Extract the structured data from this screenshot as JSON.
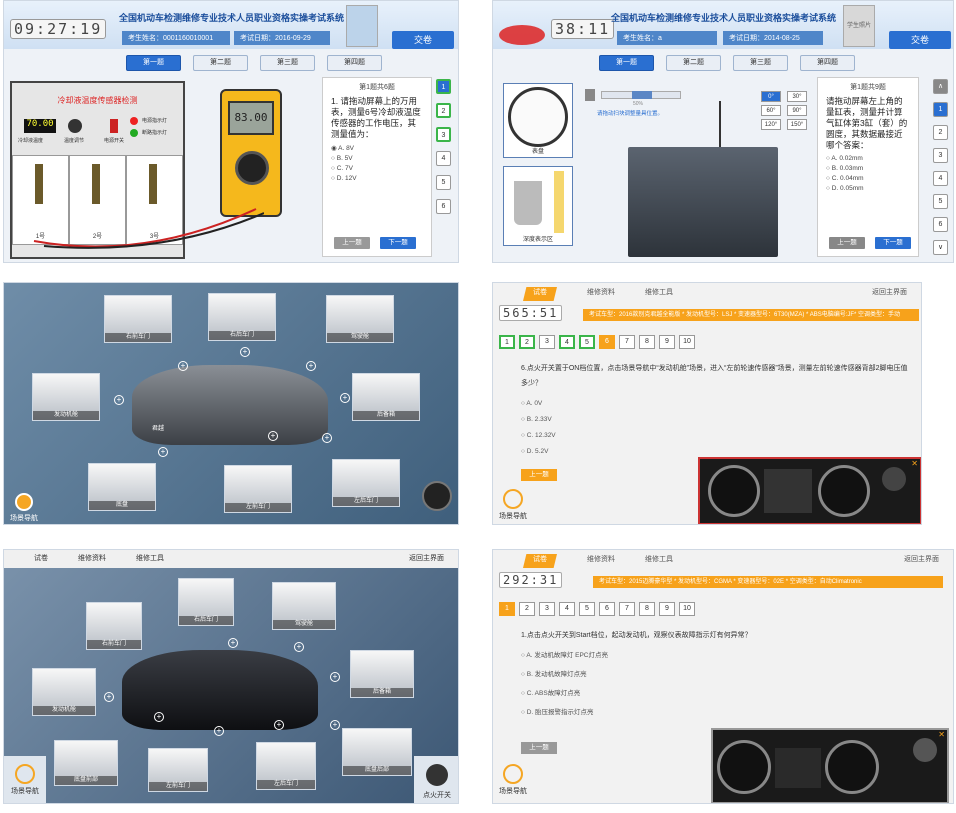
{
  "p1": {
    "timer": "09:27:19",
    "title": "全国机动车检测维修专业技术人员职业资格实操考试系统",
    "examinee": "考生姓名：0001160010001",
    "date": "考试日期：2016-09-29",
    "submit": "交卷",
    "tabs": [
      "第一题",
      "第二题",
      "第三题",
      "第四题"
    ],
    "device_title": "冷却液温度传感器检测",
    "display": "70.00",
    "labels": [
      "冷却液温度",
      "温度调节",
      "电源开关",
      "电源指示灯",
      "断路指示灯"
    ],
    "sensors": [
      "1号",
      "2号",
      "3号"
    ],
    "mm_value": "83.00",
    "q_head": "第1题共6题",
    "q_text": "1. 请拖动屏幕上的万用表，测量6号冷却液温度传感器的工作电压，其测量值为：",
    "options": [
      "A. 8V",
      "B. 5V",
      "C. 7V",
      "D. 12V"
    ],
    "prev": "上一题",
    "next": "下一题",
    "qnums": [
      "1",
      "2",
      "3",
      "4",
      "5",
      "6"
    ]
  },
  "p2": {
    "timer": "38:11",
    "title": "全国机动车检测维修专业技术人员职业资格实操考试系统",
    "examinee": "考生姓名：a",
    "date": "考试日期：2014-08-25",
    "avatar": "学生照片",
    "submit": "交卷",
    "tabs": [
      "第一题",
      "第二题",
      "第三题",
      "第四题"
    ],
    "gauge_label": "表盘",
    "depth_label": "深度表示区",
    "instruction": "请拖动扫块调整量具位置。",
    "slider_percent": "50%",
    "angles": [
      "0°",
      "30°",
      "60°",
      "90°",
      "120°",
      "150°"
    ],
    "q_head": "第1题共9题",
    "q_text": "请拖动屏幕左上角的量缸表，测量并计算气缸体第3缸（套）的圆度，其数据最接近哪个答案：",
    "options": [
      "A. 0.02mm",
      "B. 0.03mm",
      "C. 0.04mm",
      "D. 0.05mm"
    ],
    "prev": "上一题",
    "next": "下一题",
    "qnums": [
      "1",
      "2",
      "3",
      "4",
      "5",
      "6"
    ],
    "up": "∧",
    "down": "∨"
  },
  "p3": {
    "thumbs": [
      "右前车门",
      "右后车门",
      "驾驶舱",
      "发动机舱",
      "后备箱",
      "底盘",
      "左前车门",
      "左后车门"
    ],
    "car_badge": "君越",
    "nav": "场景导航"
  },
  "p4": {
    "menu": [
      "试卷",
      "维修资料",
      "维修工具"
    ],
    "back": "返回主界面",
    "timer": "565:51",
    "bar": "考试车型：2016款别克君越全能版 * 发动机型号：LSJ * 变速器型号：6T30(MZA) * ABS电脑编号:JF* 空调类型：手动",
    "qnums": [
      "1",
      "2",
      "3",
      "4",
      "5",
      "6",
      "7",
      "8",
      "9",
      "10"
    ],
    "q_text": "6.点火开关置于ON档位置，点击场景导航中“发动机舱”场景，进入“左前轮速传感器”场景，测量左前轮速传感器背部2脚电压值多少？",
    "options": [
      "A. 0V",
      "B. 2.33V",
      "C. 12.32V",
      "D. 5.2V"
    ],
    "prev": "上一题",
    "nav": "场景导航"
  },
  "p5": {
    "menu": [
      "试卷",
      "维修资料",
      "维修工具"
    ],
    "back": "返回主界面",
    "thumbs": [
      "右前车门",
      "右后车门",
      "驾驶舱",
      "发动机舱",
      "后备箱",
      "底盘前部",
      "左前车门",
      "左后车门",
      "底盘后部"
    ],
    "nav": "场景导航",
    "ignition": "点火开关"
  },
  "p6": {
    "menu": [
      "试卷",
      "维修资料",
      "维修工具"
    ],
    "back": "返回主界面",
    "timer": "292:31",
    "bar": "考试车型：2015迈腾豪华型 * 发动机型号：CGMA * 变速器型号：02E * 空调类型：自动Climatronic",
    "qnums": [
      "1",
      "2",
      "3",
      "4",
      "5",
      "6",
      "7",
      "8",
      "9",
      "10"
    ],
    "q_text": "1.点击点火开关到Start档位，起动发动机，观察仪表故障指示灯有何异常？",
    "options": [
      "A. 发动机故障灯 EPC灯点亮",
      "B. 发动机故障灯点亮",
      "C. ABS故障灯点亮",
      "D. 胎压报警指示灯点亮"
    ],
    "prev": "上一题",
    "nav": "场景导航"
  }
}
